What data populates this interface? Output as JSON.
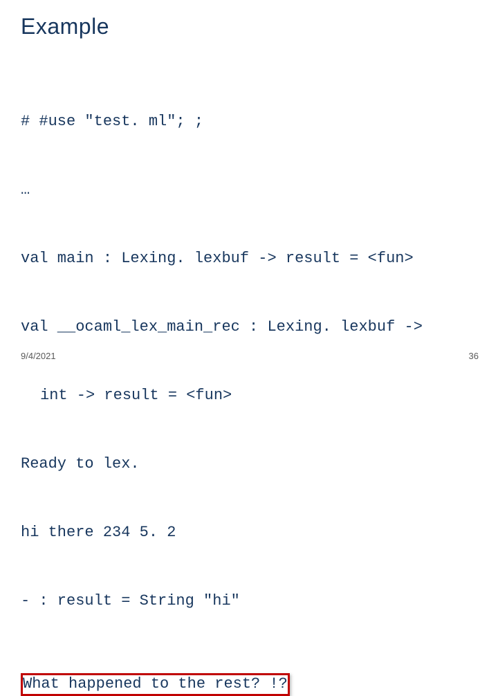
{
  "title": "Example",
  "code": {
    "l1": "# #use \"test. ml\"; ;",
    "l2": "…",
    "l3": "val main : Lexing. lexbuf -> result = <fun>",
    "l4": "val __ocaml_lex_main_rec : Lexing. lexbuf ->",
    "l5": "int -> result = <fun>",
    "l6": "Ready to lex.",
    "l7": "hi there 234 5. 2",
    "l8": "- : result = String \"hi\""
  },
  "callout": "What happened to the rest? !?",
  "footer": {
    "date": "9/4/2021",
    "page": "36"
  }
}
